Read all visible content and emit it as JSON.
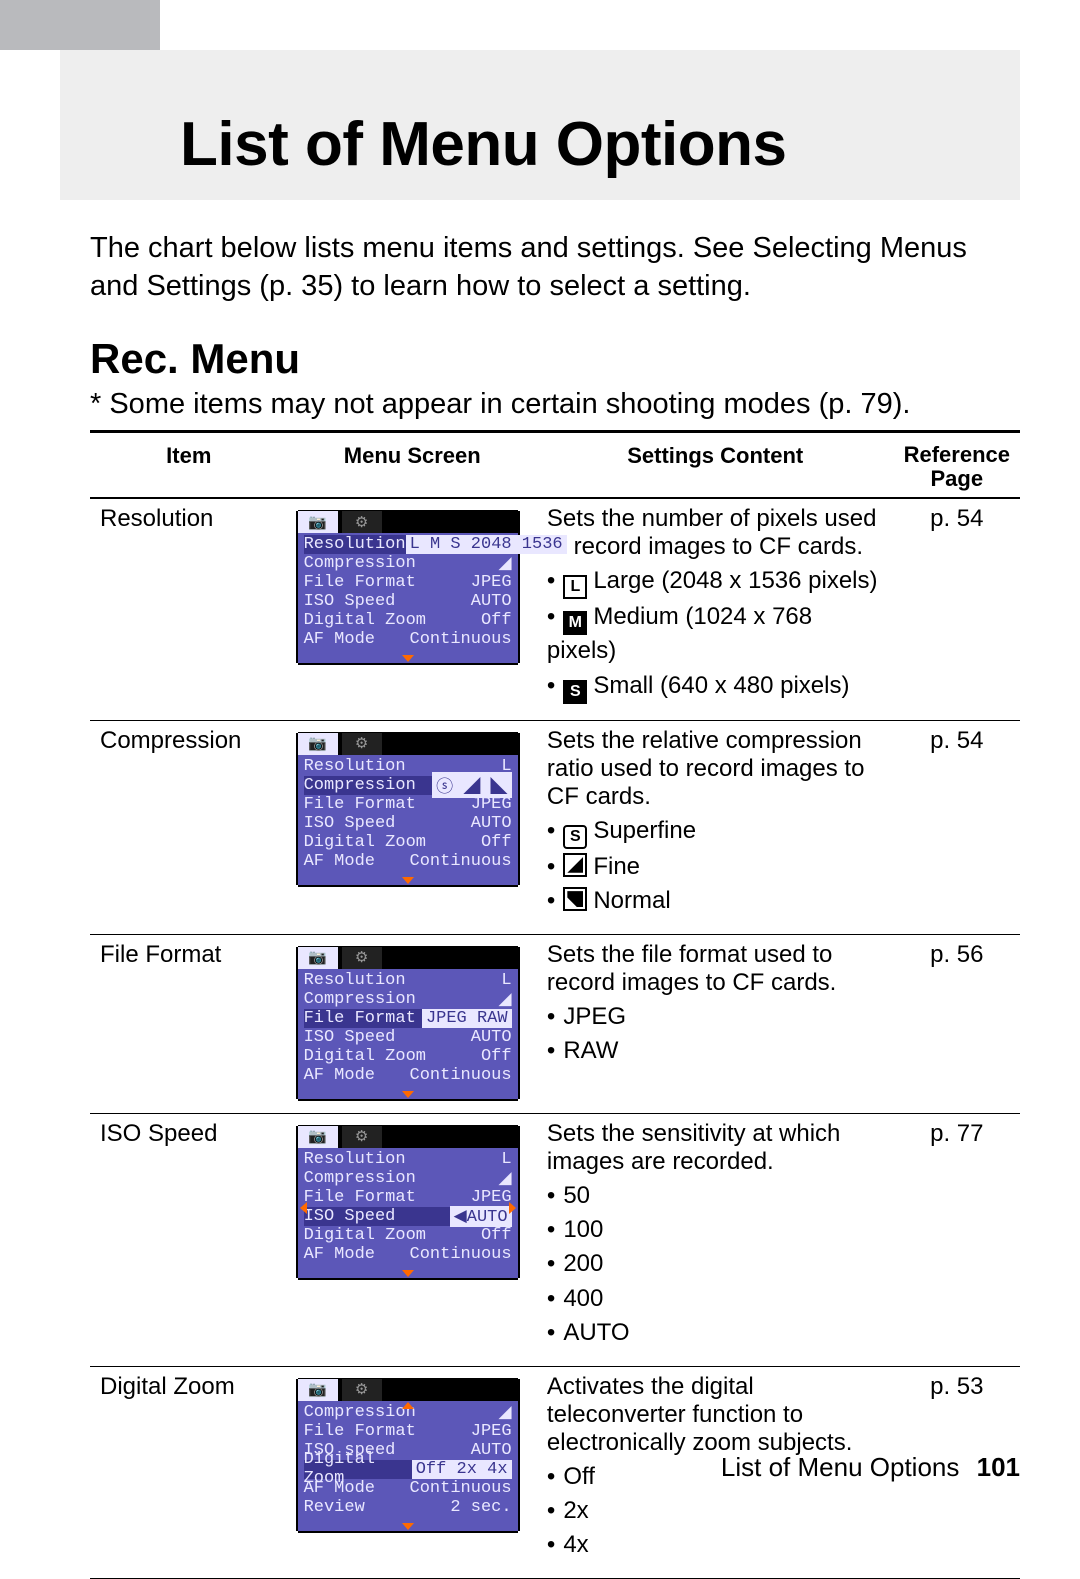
{
  "page_title": "List of Menu Options",
  "intro": "The chart below lists menu items and settings. See Selecting Menus and Settings (p. 35) to learn how to select a setting.",
  "section_title": "Rec. Menu",
  "section_note": "* Some items may not appear in certain shooting modes (p. 79).",
  "columns": {
    "item": "Item",
    "menu": "Menu Screen",
    "settings": "Settings Content",
    "ref": "Reference Page"
  },
  "lcd_common": {
    "tabs": [
      "📷",
      "⚙"
    ],
    "rows_base": [
      {
        "k": "Resolution",
        "v": "L"
      },
      {
        "k": "Compression",
        "v": "◢"
      },
      {
        "k": "File Format",
        "v": "JPEG"
      },
      {
        "k": "ISO Speed",
        "v": "AUTO"
      },
      {
        "k": "Digital Zoom",
        "v": "Off"
      },
      {
        "k": "AF Mode",
        "v": "Continuous"
      }
    ]
  },
  "rows": [
    {
      "item": "Resolution",
      "settings_intro": "Sets the number of pixels used to record images to CF cards.",
      "options": [
        {
          "glyph": "L",
          "glyph_style": "box",
          "text": "Large (2048 x 1536 pixels)"
        },
        {
          "glyph": "M",
          "glyph_style": "dark",
          "text": "Medium (1024 x 768 pixels)"
        },
        {
          "glyph": "S",
          "glyph_style": "dark",
          "text": "Small (640 x 480 pixels)"
        }
      ],
      "ref": "p. 54",
      "lcd": {
        "highlight": 0,
        "val_override": "L M S  2048 1536",
        "side_arrows": false
      }
    },
    {
      "item": "Compression",
      "settings_intro": "Sets the relative compression ratio used to record images to CF cards.",
      "options": [
        {
          "glyph": "S",
          "glyph_style": "round",
          "text": "Superfine"
        },
        {
          "glyph": "",
          "glyph_style": "shape",
          "text": "Fine"
        },
        {
          "glyph": "",
          "glyph_style": "normal",
          "text": "Normal"
        }
      ],
      "ref": "p. 54",
      "lcd": {
        "highlight": 1,
        "val_override": "ⓢ ◢ ◣",
        "side_arrows": false
      }
    },
    {
      "item": "File Format",
      "settings_intro": "Sets the file format used to record images to CF cards.",
      "options": [
        {
          "glyph": null,
          "text": "JPEG"
        },
        {
          "glyph": null,
          "text": "RAW"
        }
      ],
      "ref": "p. 56",
      "lcd": {
        "highlight": 2,
        "val_override": "JPEG RAW",
        "side_arrows": false
      }
    },
    {
      "item": "ISO Speed",
      "settings_intro": "Sets the sensitivity at which images are recorded.",
      "options": [
        {
          "glyph": null,
          "text": "50"
        },
        {
          "glyph": null,
          "text": "100"
        },
        {
          "glyph": null,
          "text": "200"
        },
        {
          "glyph": null,
          "text": "400"
        },
        {
          "glyph": null,
          "text": "AUTO"
        }
      ],
      "ref": "p. 77",
      "lcd": {
        "highlight": 3,
        "val_override": "◀AUTO",
        "side_arrows": true
      }
    },
    {
      "item": "Digital Zoom",
      "settings_intro": "Activates the digital teleconverter function to electronically zoom subjects.",
      "options": [
        {
          "glyph": null,
          "text": "Off"
        },
        {
          "glyph": null,
          "text": "2x"
        },
        {
          "glyph": null,
          "text": "4x"
        }
      ],
      "ref": "p. 53",
      "lcd": {
        "highlight": 3,
        "rows_override": [
          {
            "k": "Compression",
            "v": "◢"
          },
          {
            "k": "File Format",
            "v": "JPEG"
          },
          {
            "k": "ISO speed",
            "v": "AUTO"
          },
          {
            "k": "Digital Zoom",
            "v": "Off 2x 4x"
          },
          {
            "k": "AF Mode",
            "v": "Continuous"
          },
          {
            "k": "Review",
            "v": "2 sec."
          }
        ],
        "side_arrows": false,
        "top_arrow": true
      }
    }
  ],
  "footer": {
    "label": "List of Menu Options",
    "page": "101"
  }
}
